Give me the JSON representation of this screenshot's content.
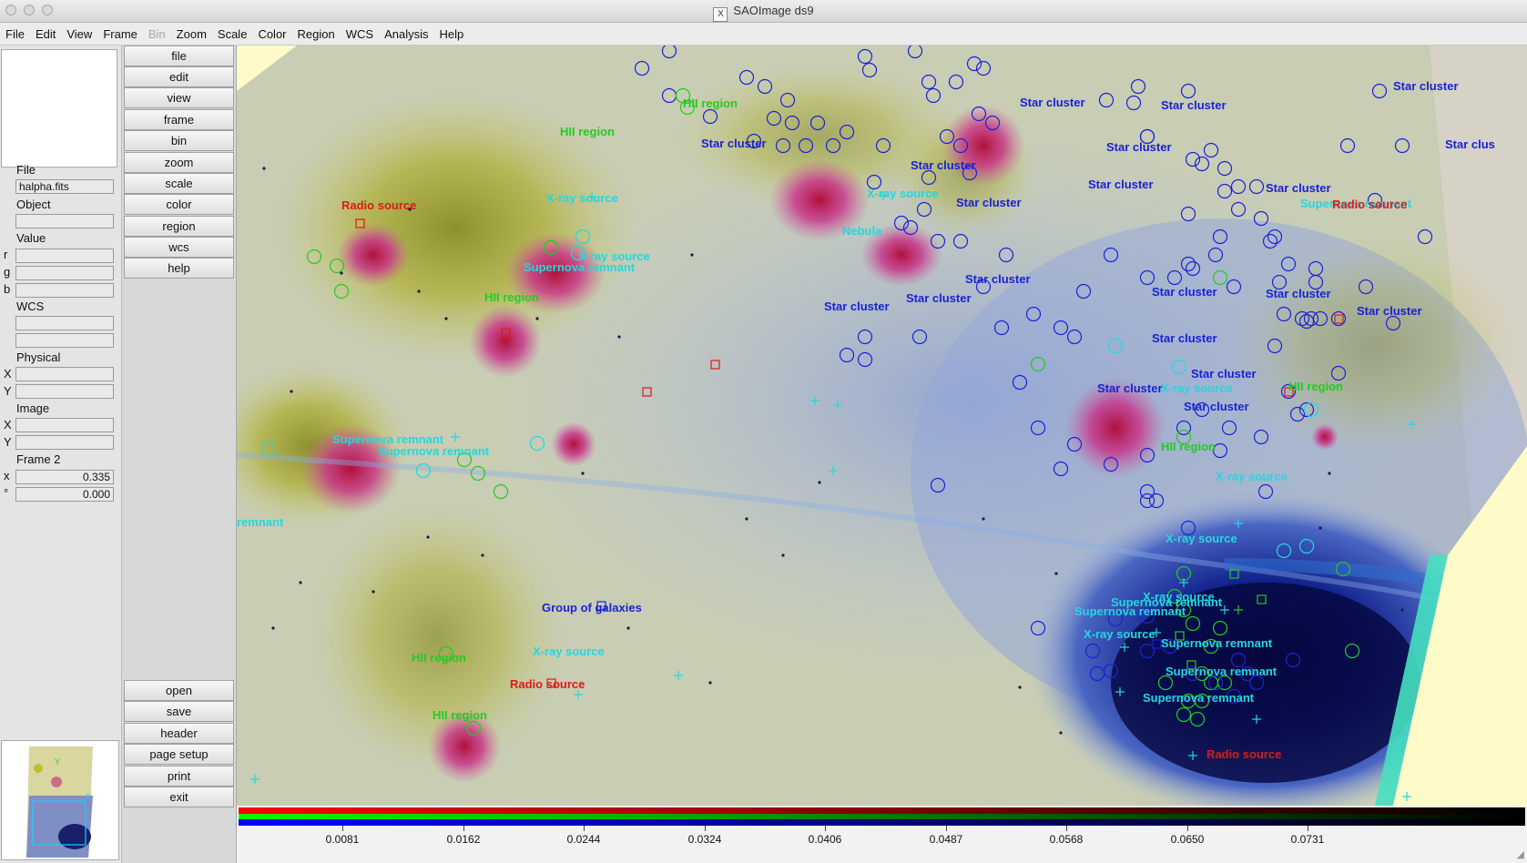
{
  "window": {
    "title": "SAOImage ds9",
    "app_icon": "X"
  },
  "menubar": {
    "items": [
      {
        "label": "File",
        "enabled": true
      },
      {
        "label": "Edit",
        "enabled": true
      },
      {
        "label": "View",
        "enabled": true
      },
      {
        "label": "Frame",
        "enabled": true
      },
      {
        "label": "Bin",
        "enabled": false
      },
      {
        "label": "Zoom",
        "enabled": true
      },
      {
        "label": "Scale",
        "enabled": true
      },
      {
        "label": "Color",
        "enabled": true
      },
      {
        "label": "Region",
        "enabled": true
      },
      {
        "label": "WCS",
        "enabled": true
      },
      {
        "label": "Analysis",
        "enabled": true
      },
      {
        "label": "Help",
        "enabled": true
      }
    ]
  },
  "info_panel": {
    "file_label": "File",
    "file_value": "halpha.fits",
    "object_label": "Object",
    "object_value": "",
    "value_label": "Value",
    "value_r": "r",
    "value_g": "g",
    "value_b": "b",
    "wcs_label": "WCS",
    "physical_label": "Physical",
    "physical_x": "X",
    "physical_y": "Y",
    "image_label": "Image",
    "image_x": "X",
    "image_y": "Y",
    "frame_label": "Frame 2",
    "zoom_symbol": "x",
    "zoom_value": "0.335",
    "angle_symbol": "°",
    "angle_value": "0.000"
  },
  "buttons": {
    "top": [
      "file",
      "edit",
      "view",
      "frame",
      "bin",
      "zoom",
      "scale",
      "color",
      "region",
      "wcs",
      "help"
    ],
    "bottom": [
      "open",
      "save",
      "header",
      "page setup",
      "print",
      "exit"
    ]
  },
  "colorbar": {
    "ticks": [
      "0.0081",
      "0.0162",
      "0.0244",
      "0.0324",
      "0.0406",
      "0.0487",
      "0.0568",
      "0.0650",
      "0.0731"
    ]
  },
  "colors": {
    "star_cluster": "#1a22d6",
    "hii_region": "#22cc22",
    "xray_source": "#22d8e0",
    "radio_source": "#e01818",
    "supernova_remnant": "#22d8e0",
    "nebula": "#22d8e0",
    "galaxy_group": "#1a22d6"
  },
  "regions": {
    "labels": [
      {
        "text": "HII region",
        "type": "hii_region"
      },
      {
        "text": "HII region",
        "type": "hii_region"
      },
      {
        "text": "Star cluster",
        "type": "star_cluster"
      },
      {
        "text": "Star cluster",
        "type": "star_cluster"
      },
      {
        "text": "Star cluster",
        "type": "star_cluster"
      },
      {
        "text": "Star cluster",
        "type": "star_cluster"
      },
      {
        "text": "Star cluster",
        "type": "star_cluster"
      },
      {
        "text": "Star clus",
        "type": "star_cluster"
      },
      {
        "text": "Star cluster",
        "type": "star_cluster"
      },
      {
        "text": "X-ray source",
        "type": "xray_source"
      },
      {
        "text": "Radio source",
        "type": "radio_source"
      },
      {
        "text": "X-ray source",
        "type": "xray_source"
      },
      {
        "text": "X-ray source",
        "type": "xray_source"
      },
      {
        "text": "Supernova remnant",
        "type": "supernova_remnant"
      },
      {
        "text": "Nebula",
        "type": "nebula"
      },
      {
        "text": "Star cluster",
        "type": "star_cluster"
      },
      {
        "text": "Star cluster",
        "type": "star_cluster"
      },
      {
        "text": "Star cluster",
        "type": "star_cluster"
      },
      {
        "text": "Supernova remnant",
        "type": "supernova_remnant"
      },
      {
        "text": "Radio source",
        "type": "radio_source"
      },
      {
        "text": "HII region",
        "type": "hii_region"
      },
      {
        "text": "Star cluster",
        "type": "star_cluster"
      },
      {
        "text": "Star cluster",
        "type": "star_cluster"
      },
      {
        "text": "Star cluster",
        "type": "star_cluster"
      },
      {
        "text": "Star cluster",
        "type": "star_cluster"
      },
      {
        "text": "Star cluster",
        "type": "star_cluster"
      },
      {
        "text": "Star cluster",
        "type": "star_cluster"
      },
      {
        "text": "Star cluster",
        "type": "star_cluster"
      },
      {
        "text": "X-ray source",
        "type": "xray_source"
      },
      {
        "text": "Star cluster",
        "type": "star_cluster"
      },
      {
        "text": "Star cluster",
        "type": "star_cluster"
      },
      {
        "text": "HII region",
        "type": "hii_region"
      },
      {
        "text": "Star cluster",
        "type": "star_cluster"
      },
      {
        "text": "HII region",
        "type": "hii_region"
      },
      {
        "text": "Supernova remnant",
        "type": "supernova_remnant"
      },
      {
        "text": "Supernova remnant",
        "type": "supernova_remnant"
      },
      {
        "text": "remnant",
        "type": "supernova_remnant"
      },
      {
        "text": "X-ray source",
        "type": "xray_source"
      },
      {
        "text": "X-ray source",
        "type": "xray_source"
      },
      {
        "text": "Group of galaxies",
        "type": "galaxy_group"
      },
      {
        "text": "X-ray source",
        "type": "xray_source"
      },
      {
        "text": "HII region",
        "type": "hii_region"
      },
      {
        "text": "Radio source",
        "type": "radio_source"
      },
      {
        "text": "HII region",
        "type": "hii_region"
      },
      {
        "text": "X-ray source",
        "type": "xray_source"
      },
      {
        "text": "Supernova remnant",
        "type": "supernova_remnant"
      },
      {
        "text": "Supernova remnant",
        "type": "supernova_remnant"
      },
      {
        "text": "X-ray source",
        "type": "xray_source"
      },
      {
        "text": "Supernova remnant",
        "type": "supernova_remnant"
      },
      {
        "text": "Supernova remnant",
        "type": "supernova_remnant"
      },
      {
        "text": "Supernova remnant",
        "type": "supernova_remnant"
      },
      {
        "text": "Radio source",
        "type": "radio_source"
      }
    ]
  }
}
